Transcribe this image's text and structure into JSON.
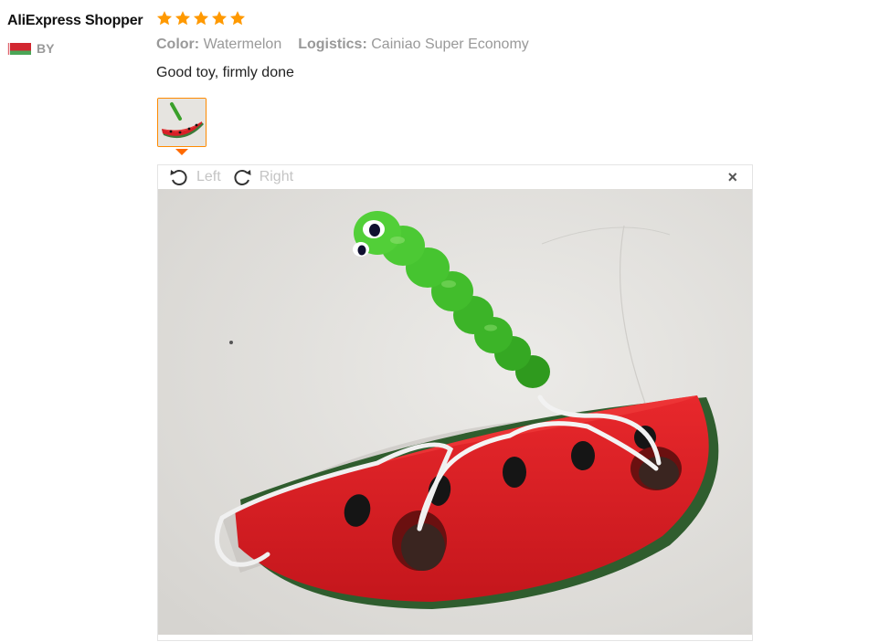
{
  "user": {
    "name": "AliExpress Shopper",
    "country_code": "BY"
  },
  "review": {
    "rating": 5,
    "rating_max": 5,
    "attributes": [
      {
        "key": "Color:",
        "value": "Watermelon"
      },
      {
        "key": "Logistics:",
        "value": "Cainiao Super Economy"
      }
    ],
    "text": "Good toy, firmly done"
  },
  "viewer": {
    "rotate_left_label": "Left",
    "rotate_right_label": "Right",
    "close_symbol": "×"
  },
  "colors": {
    "star": "#ff9900",
    "accent": "#ff6a00",
    "muted": "#c4c4c4"
  }
}
